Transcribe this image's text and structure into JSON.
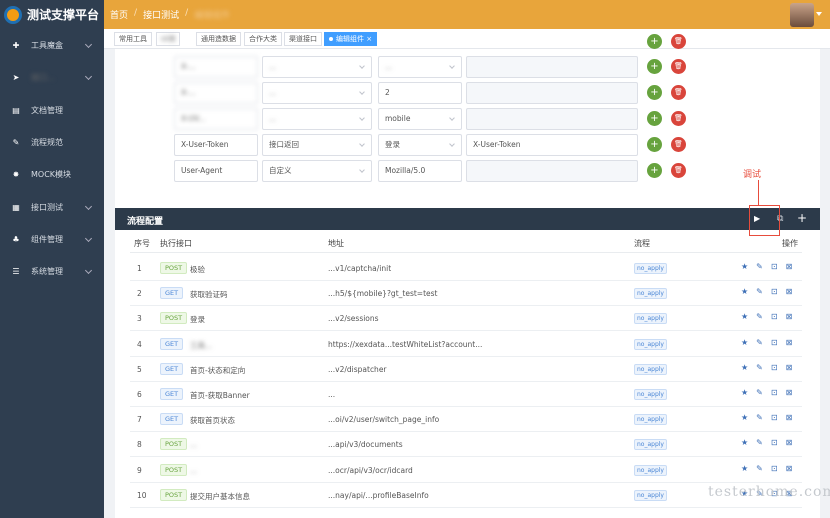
{
  "app": {
    "title": "测试支撑平台"
  },
  "breadcrumb": {
    "home": "首页",
    "section": "接口测试",
    "current": "编辑组件"
  },
  "sidebar": {
    "items": [
      {
        "icon": "toolbox-icon",
        "glyph": "✚",
        "label": "工具魔盒",
        "expandable": true
      },
      {
        "icon": "send-icon",
        "glyph": "➤",
        "label": "接口...",
        "expandable": true
      },
      {
        "icon": "doc-icon",
        "glyph": "▤",
        "label": "文档管理",
        "expandable": false
      },
      {
        "icon": "flow-icon",
        "glyph": "✎",
        "label": "流程规范",
        "expandable": false
      },
      {
        "icon": "mock-icon",
        "glyph": "✸",
        "label": "MOCK模块",
        "expandable": false
      },
      {
        "icon": "grid-icon",
        "glyph": "▦",
        "label": "接口测试",
        "expandable": true
      },
      {
        "icon": "component-icon",
        "glyph": "♣",
        "label": "组件管理",
        "expandable": true
      },
      {
        "icon": "system-icon",
        "glyph": "☰",
        "label": "系统管理",
        "expandable": true
      }
    ]
  },
  "tabs": [
    {
      "label": "常用工具",
      "active": false
    },
    {
      "label": "UI测",
      "active": false
    },
    {
      "label": "通用造数据",
      "active": false
    },
    {
      "label": "合作大类",
      "active": false
    },
    {
      "label": "渠道接口",
      "active": false
    },
    {
      "label": "编辑组件",
      "active": true,
      "close": "×"
    }
  ],
  "header_rows": [
    {
      "key": "X-...",
      "type": "...",
      "value": "...",
      "extra": ""
    },
    {
      "key": "X-...",
      "type": "...",
      "value": "2",
      "extra": ""
    },
    {
      "key": "X-UV...",
      "type": "...",
      "value": "mobile",
      "extra": ""
    },
    {
      "key": "X-User-Token",
      "type": "接口返回",
      "value": "登录",
      "extra": "X-User-Token"
    },
    {
      "key": "User-Agent",
      "type": "自定义",
      "value": "Mozilla/5.0",
      "extra": ""
    }
  ],
  "annotation": {
    "label": "调试"
  },
  "flow_config": {
    "title": "流程配置",
    "columns": {
      "no": "序号",
      "api": "执行接口",
      "url": "地址",
      "flow": "流程",
      "ops": "操作"
    },
    "rows": [
      {
        "no": "1",
        "method": "POST",
        "name": "极验",
        "url": "...v1/captcha/init",
        "flow": "no_apply"
      },
      {
        "no": "2",
        "method": "GET",
        "name": "获取验证码",
        "url": "...h5/${mobile}?gt_test=test",
        "flow": "no_apply"
      },
      {
        "no": "3",
        "method": "POST",
        "name": "登录",
        "url": "...v2/sessions",
        "flow": "no_apply"
      },
      {
        "no": "4",
        "method": "GET",
        "name": "工具...",
        "url": "https://xexdata...testWhiteList?account...",
        "flow": "no_apply"
      },
      {
        "no": "5",
        "method": "GET",
        "name": "首页-状态和定向",
        "url": "...v2/dispatcher",
        "flow": "no_apply"
      },
      {
        "no": "6",
        "method": "GET",
        "name": "首页-获取Banner",
        "url": "...",
        "flow": "no_apply"
      },
      {
        "no": "7",
        "method": "GET",
        "name": "获取首页状态",
        "url": "...oi/v2/user/switch_page_info",
        "flow": "no_apply"
      },
      {
        "no": "8",
        "method": "POST",
        "name": "...",
        "url": "...api/v3/documents",
        "flow": "no_apply"
      },
      {
        "no": "9",
        "method": "POST",
        "name": "...",
        "url": "...ocr/api/v3/ocr/idcard",
        "flow": "no_apply"
      },
      {
        "no": "10",
        "method": "POST",
        "name": "提交用户基本信息",
        "url": "...nay/api/...profileBaseInfo",
        "flow": "no_apply"
      }
    ]
  },
  "icons": {
    "add": "+",
    "delete": "🗑",
    "star": "★",
    "edit": "✎",
    "lock": "⊡",
    "trash": "⊠",
    "run": "▶",
    "copy": "⧉",
    "plus": "+"
  },
  "watermark": "testerhome.com",
  "colors": {
    "topbar": "#e8a53b",
    "sidebar": "#2f3e50",
    "accent": "#409eff",
    "annotation": "#e74c3c"
  }
}
